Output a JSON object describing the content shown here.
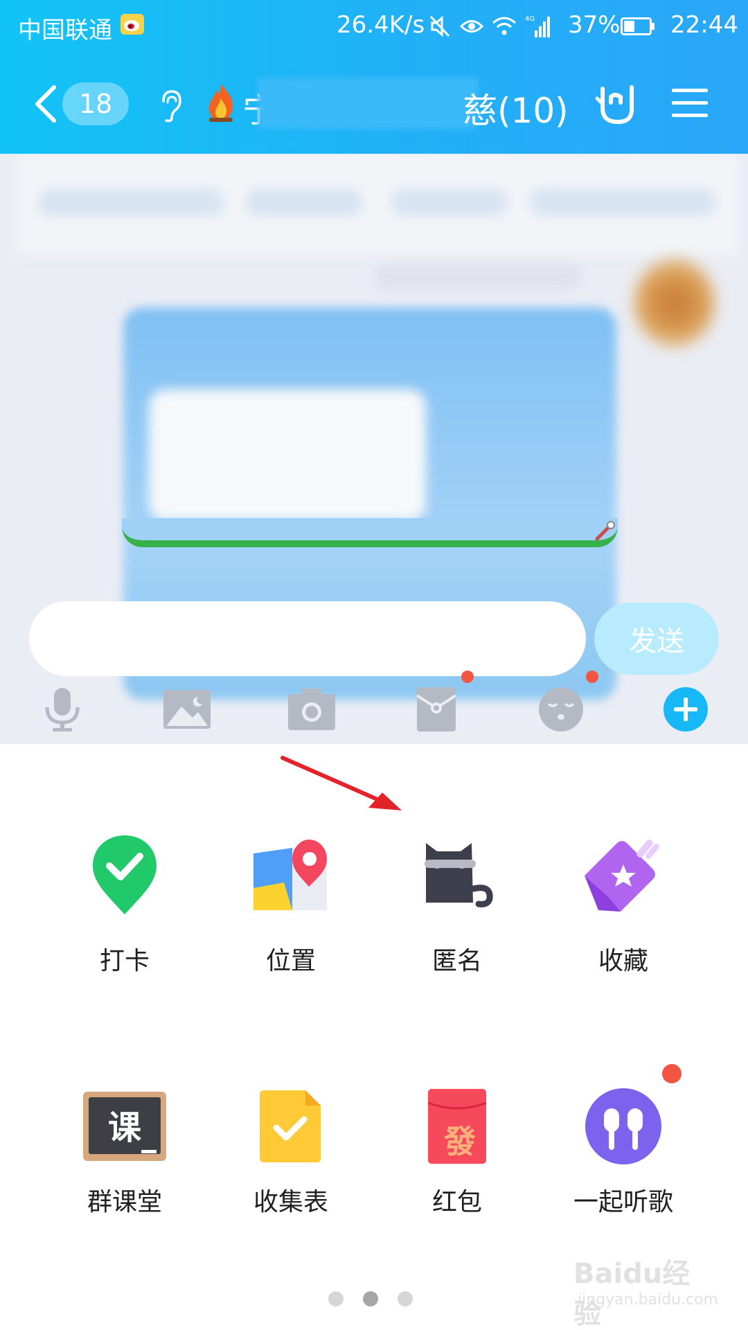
{
  "status_bar": {
    "carrier": "中国联通",
    "net_speed": "26.4K/s",
    "network_type": "4G",
    "battery_percent": "37%",
    "time": "22:44"
  },
  "title_bar": {
    "back_badge": "18",
    "title_visible_start": "宁",
    "title_visible_end": "慈",
    "member_count": "(10)"
  },
  "composer": {
    "input_value": "",
    "send_label": "发送"
  },
  "toolbar_icons": [
    "microphone-icon",
    "image-icon",
    "camera-icon",
    "red-envelope-icon",
    "emoji-icon",
    "plus-icon"
  ],
  "apps": [
    {
      "label": "打卡",
      "icon": "check-in-pin-icon"
    },
    {
      "label": "位置",
      "icon": "location-map-icon"
    },
    {
      "label": "匿名",
      "icon": "anonymous-cat-icon"
    },
    {
      "label": "收藏",
      "icon": "favorite-star-icon"
    },
    {
      "label": "群课堂",
      "icon": "blackboard-icon"
    },
    {
      "label": "收集表",
      "icon": "form-collect-icon"
    },
    {
      "label": "红包",
      "icon": "red-packet-icon"
    },
    {
      "label": "一起听歌",
      "icon": "earphones-icon"
    }
  ],
  "pager": {
    "total": 3,
    "active": 2
  },
  "watermark": {
    "main": "Baidu经验",
    "sub": "jingyan.baidu.com"
  },
  "colors": {
    "header": "#21b0f7",
    "send_button": "#b7ebfd",
    "notification_dot": "#f25643",
    "plus_button": "#16b9f6"
  }
}
